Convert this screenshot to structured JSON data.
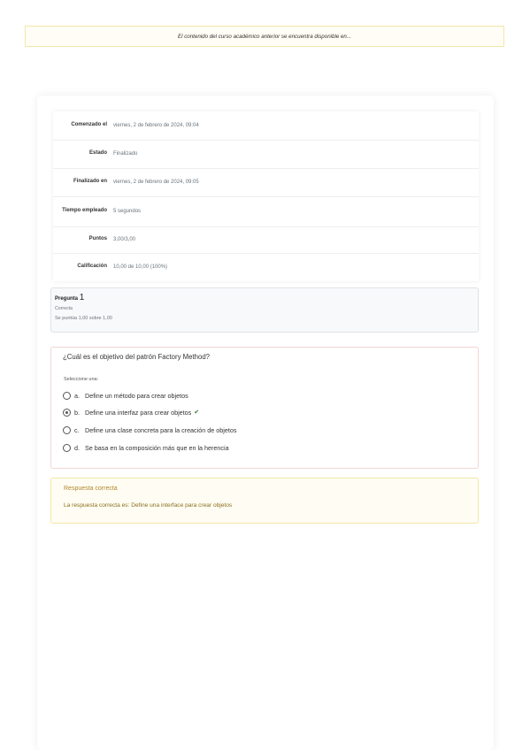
{
  "notice": {
    "text": "El contenido del curso académico anterior se encuentra disponible en..."
  },
  "summary": {
    "rows": [
      {
        "label": "Comenzado el",
        "value": "viernes, 2 de febrero de 2024, 09:04"
      },
      {
        "label": "Estado",
        "value": "Finalizado"
      },
      {
        "label": "Finalizado en",
        "value": "viernes, 2 de febrero de 2024, 09:05"
      },
      {
        "label": "Tiempo empleado",
        "value": "5 segundos"
      },
      {
        "label": "Puntos",
        "value": "3,00/3,00"
      },
      {
        "label": "Calificación",
        "value": "10,00 de 10,00 (100%)"
      }
    ]
  },
  "question": {
    "label": "Pregunta",
    "number": "1",
    "state": "Correcta",
    "grade": "Se puntúa 1,00 sobre 1,00",
    "text": "¿Cuál es el objetivo del patrón Factory Method?",
    "prompt": "Seleccione una:",
    "answers": [
      {
        "letter": "a.",
        "text": "Define un método para crear objetos"
      },
      {
        "letter": "b.",
        "text": "Define una interfaz para crear objetos"
      },
      {
        "letter": "c.",
        "text": "Define una clase concreta para la creación de objetos"
      },
      {
        "letter": "d.",
        "text": "Se basa en la composición más que en la herencia"
      }
    ],
    "selected_index": 1
  },
  "feedback": {
    "title": "Respuesta correcta",
    "text": "La respuesta correcta es: Define una interface para crear objetos"
  },
  "icons": {
    "correct": "check-icon"
  },
  "colors": {
    "correct_green": "#357a32",
    "feedback_text": "#8a6d1c",
    "incorrect_border": "#f2d5d5"
  }
}
